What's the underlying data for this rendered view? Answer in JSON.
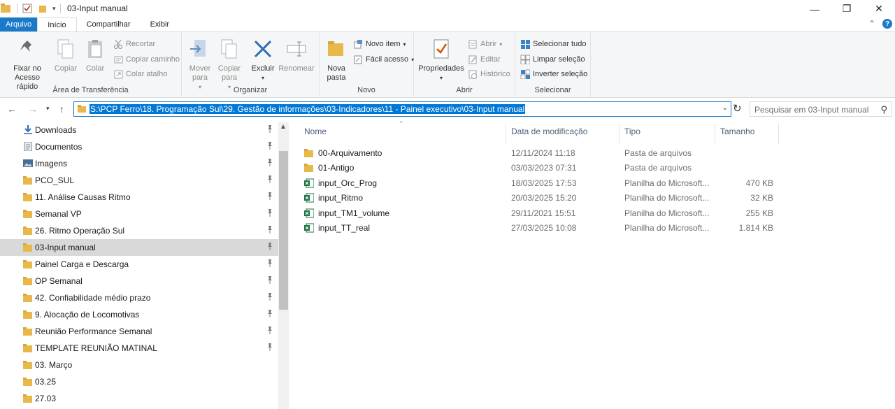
{
  "window": {
    "title": "03-Input manual"
  },
  "tabs": [
    "Arquivo",
    "Início",
    "Compartilhar",
    "Exibir"
  ],
  "ribbon": {
    "clipboard": {
      "label": "Área de Transferência",
      "pin": "Fixar no Acesso rápido",
      "copy": "Copiar",
      "paste": "Colar",
      "cut": "Recortar",
      "copy_path": "Copiar caminho",
      "paste_shortcut": "Colar atalho"
    },
    "organize": {
      "label": "Organizar",
      "move_to": "Mover para",
      "copy_to": "Copiar para",
      "delete": "Excluir",
      "rename": "Renomear"
    },
    "new": {
      "label": "Novo",
      "new_folder": "Nova pasta",
      "new_item": "Novo item",
      "easy_access": "Fácil acesso"
    },
    "open": {
      "label": "Abrir",
      "properties": "Propriedades",
      "open": "Abrir",
      "edit": "Editar",
      "history": "Histórico"
    },
    "select": {
      "label": "Selecionar",
      "select_all": "Selecionar tudo",
      "select_none": "Limpar seleção",
      "invert": "Inverter seleção"
    }
  },
  "address": {
    "path": "S:\\PCP Ferro\\18. Programação Sul\\29. Gestão de informações\\03-Indicadores\\11 - Painel executivo\\03-Input manual",
    "search_placeholder": "Pesquisar em 03-Input manual"
  },
  "nav_items": [
    {
      "label": "Downloads",
      "icon": "download-icon",
      "pinned": true
    },
    {
      "label": "Documentos",
      "icon": "documents-icon",
      "pinned": true
    },
    {
      "label": "Imagens",
      "icon": "pictures-icon",
      "pinned": true
    },
    {
      "label": "PCO_SUL",
      "icon": "folder-icon",
      "pinned": true
    },
    {
      "label": "11. Análise Causas Ritmo",
      "icon": "folder-icon",
      "pinned": true
    },
    {
      "label": "Semanal VP",
      "icon": "folder-icon",
      "pinned": true
    },
    {
      "label": "26. Ritmo Operação Sul",
      "icon": "folder-icon",
      "pinned": true
    },
    {
      "label": "03-Input manual",
      "icon": "folder-icon",
      "pinned": true,
      "selected": true
    },
    {
      "label": "Painel Carga e Descarga",
      "icon": "folder-icon",
      "pinned": true
    },
    {
      "label": "OP Semanal",
      "icon": "folder-icon",
      "pinned": true
    },
    {
      "label": "42. Confiabilidade médio prazo",
      "icon": "folder-icon",
      "pinned": true
    },
    {
      "label": "9. Alocação de Locomotivas",
      "icon": "folder-icon",
      "pinned": true
    },
    {
      "label": "Reunião Performance Semanal",
      "icon": "folder-icon",
      "pinned": true
    },
    {
      "label": "TEMPLATE REUNIÃO MATINAL",
      "icon": "folder-icon",
      "pinned": true
    },
    {
      "label": "03. Março",
      "icon": "folder-icon",
      "pinned": false
    },
    {
      "label": "03.25",
      "icon": "folder-icon",
      "pinned": false
    },
    {
      "label": "27.03",
      "icon": "folder-icon",
      "pinned": false
    }
  ],
  "columns": {
    "name": "Nome",
    "date": "Data de modificação",
    "type": "Tipo",
    "size": "Tamanho"
  },
  "files": [
    {
      "name": "00-Arquivamento",
      "date": "12/11/2024 11:18",
      "type": "Pasta de arquivos",
      "size": "",
      "icon": "folder-icon"
    },
    {
      "name": "01-Antigo",
      "date": "03/03/2023 07:31",
      "type": "Pasta de arquivos",
      "size": "",
      "icon": "folder-icon"
    },
    {
      "name": "input_Orc_Prog",
      "date": "18/03/2025 17:53",
      "type": "Planilha do Microsoft...",
      "size": "470 KB",
      "icon": "excel-icon"
    },
    {
      "name": "input_Ritmo",
      "date": "20/03/2025 15:20",
      "type": "Planilha do Microsoft...",
      "size": "32 KB",
      "icon": "excel-icon"
    },
    {
      "name": "input_TM1_volume",
      "date": "29/11/2021 15:51",
      "type": "Planilha do Microsoft...",
      "size": "255 KB",
      "icon": "excel-icon"
    },
    {
      "name": "input_TT_real",
      "date": "27/03/2025 10:08",
      "type": "Planilha do Microsoft...",
      "size": "1.814 KB",
      "icon": "excel-icon"
    }
  ],
  "colors": {
    "accent": "#1979ca",
    "selection": "#0078d7",
    "folder": "#e8b84a",
    "excel": "#1d7044"
  }
}
